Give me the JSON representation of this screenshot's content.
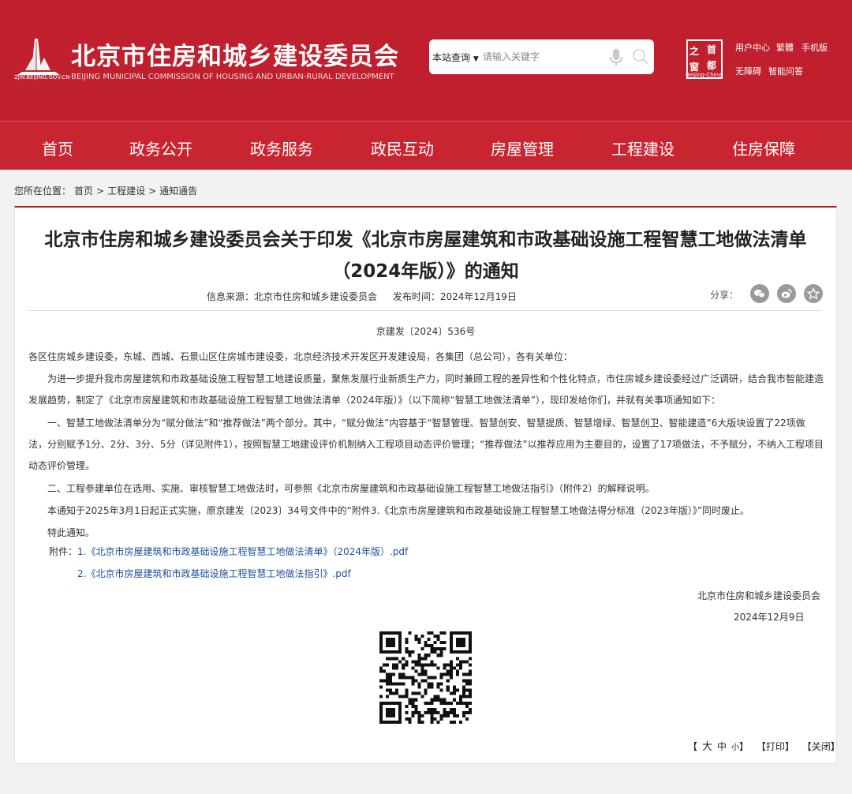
{
  "header": {
    "title": "北京市住房和城乡建设委员会",
    "subtitle": "BEIJING MUNICIPAL COMMISSION OF HOUSING AND URBAN-RURAL DEVELOPMENT",
    "logo_url_text": "ZJW.BEIJING.GOV.CN",
    "search": {
      "scope": "本站查询",
      "placeholder": "请输入关键字"
    },
    "emblem": {
      "tl": "之",
      "tr": "首",
      "bl": "窗",
      "br": "都",
      "caption": "Beijing-China"
    },
    "links": [
      "用户中心",
      "繁體",
      "手机版",
      "无障碍",
      "智能问答"
    ]
  },
  "nav": [
    "首页",
    "政务公开",
    "政务服务",
    "政民互动",
    "房屋管理",
    "工程建设",
    "住房保障"
  ],
  "breadcrumb": {
    "prefix": "您所在位置：",
    "items": [
      "首页",
      ">",
      "工程建设",
      ">",
      "通知通告"
    ]
  },
  "article": {
    "title": "北京市住房和城乡建设委员会关于印发《北京市房屋建筑和市政基础设施工程智慧工地做法清单（2024年版）》的通知",
    "source": "信息来源：北京市住房和城乡建设委员会",
    "date": "发布时间：2024年12月19日",
    "share_label": "分享：",
    "doc_no": "京建发〔2024〕536号",
    "recipients": "各区住房城乡建设委，东城、西城、石景山区住房城市建设委，北京经济技术开发区开发建设局，各集团（总公司），各有关单位：",
    "paragraphs": [
      "为进一步提升我市房屋建筑和市政基础设施工程智慧工地建设质量，聚焦发展行业新质生产力，同时兼顾工程的差异性和个性化特点，市住房城乡建设委经过广泛调研，结合我市智能建造发展趋势，制定了《北京市房屋建筑和市政基础设施工程智慧工地做法清单（2024年版）》（以下简称“智慧工地做法清单”），现印发给你们，并就有关事项通知如下：",
      "一、智慧工地做法清单分为“赋分做法”和“推荐做法”两个部分。其中，“赋分做法”内容基于“智慧管理、智慧创安、智慧提质、智慧增绿、智慧创卫、智能建造”6大版块设置了22项做法，分别赋予1分、2分、3分、5分（详见附件1），按照智慧工地建设评价机制纳入工程项目动态评价管理；“推荐做法”以推荐应用为主要目的，设置了17项做法，不予赋分，不纳入工程项目动态评价管理。",
      "二、工程参建单位在选用、实施、审核智慧工地做法时，可参照《北京市房屋建筑和市政基础设施工程智慧工地做法指引》（附件2）的解释说明。",
      "本通知于2025年3月1日起正式实施，原京建发〔2023〕34号文件中的“附件3.《北京市房屋建筑和市政基础设施工程智慧工地做法得分标准（2023年版）》”同时废止。",
      "特此通知。"
    ],
    "attachments_label": "附件：",
    "attachments": [
      "1.《北京市房屋建筑和市政基础设施工程智慧工地做法清单》（2024年版）.pdf",
      "2.《北京市房屋建筑和市政基础设施工程智慧工地做法指引》.pdf"
    ],
    "signer": "北京市住房和城乡建设委员会",
    "sign_date": "2024年12月9日"
  },
  "footer_tools": {
    "open": "【",
    "big": "大",
    "mid": "中",
    "small": "小",
    "close": "】",
    "print": "【打印】",
    "close_win": "【关闭】"
  }
}
